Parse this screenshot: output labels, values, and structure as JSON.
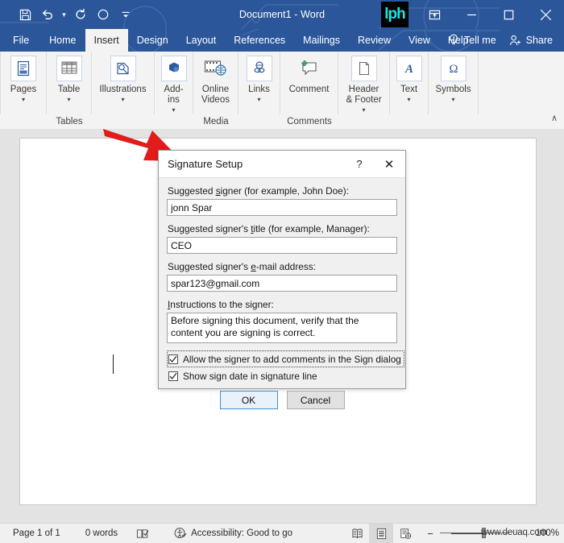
{
  "window": {
    "title": "Document1  -  Word",
    "logo_text": "lph",
    "quick_access": [
      {
        "name": "save",
        "icon": "save-icon"
      },
      {
        "name": "undo",
        "icon": "undo-icon"
      },
      {
        "name": "redo",
        "icon": "redo-icon"
      },
      {
        "name": "touch-mode",
        "icon": "circle-icon"
      },
      {
        "name": "customize-quick-access-toolbar",
        "icon": "chevron-down-icon"
      }
    ],
    "controls": [
      {
        "name": "ribbon-display-options",
        "icon": "ribbon-options-icon"
      },
      {
        "name": "minimize",
        "icon": "minimize-icon"
      },
      {
        "name": "maximize",
        "icon": "maximize-icon"
      },
      {
        "name": "close",
        "icon": "close-icon"
      }
    ]
  },
  "ribbon": {
    "tabs": [
      {
        "label": "File",
        "active": false
      },
      {
        "label": "Home",
        "active": false
      },
      {
        "label": "Insert",
        "active": true
      },
      {
        "label": "Design",
        "active": false
      },
      {
        "label": "Layout",
        "active": false
      },
      {
        "label": "References",
        "active": false
      },
      {
        "label": "Mailings",
        "active": false
      },
      {
        "label": "Review",
        "active": false
      },
      {
        "label": "View",
        "active": false
      },
      {
        "label": "Help",
        "active": false
      }
    ],
    "tell_me": "Tell me",
    "share": "Share",
    "collapse_glyph": "∧",
    "commands": [
      {
        "label": "Pages",
        "icon": "pages-icon",
        "has_chevron": true
      },
      {
        "label": "Table",
        "icon": "table-icon",
        "has_chevron": true
      },
      {
        "label": "Illustrations",
        "icon": "illustrations-icon",
        "has_chevron": true
      },
      {
        "label": "Add-ins",
        "icon": "addins-icon",
        "has_chevron": true
      },
      {
        "label": "Online Videos",
        "icon": "online-video-icon",
        "has_chevron": false
      },
      {
        "label": "Links",
        "icon": "links-icon",
        "has_chevron": true
      },
      {
        "label": "Comment",
        "icon": "comment-icon",
        "has_chevron": false
      },
      {
        "label": "Header & Footer",
        "icon": "header-footer-icon",
        "has_chevron": true
      },
      {
        "label": "Text",
        "icon": "text-icon",
        "has_chevron": true
      },
      {
        "label": "Symbols",
        "icon": "symbols-icon",
        "has_chevron": true
      }
    ],
    "group_titles": [
      "Tables",
      "Media",
      "Comments"
    ]
  },
  "dialog": {
    "title": "Signature Setup",
    "help_glyph": "?",
    "close_glyph": "✕",
    "fields": [
      {
        "name": "suggested-signer",
        "label_pre": "Suggested ",
        "label_accel": "s",
        "label_post": "igner (for example, John Doe):",
        "value": "jonn Spar"
      },
      {
        "name": "suggested-signer-title",
        "label_pre": "Suggested signer's ",
        "label_accel": "t",
        "label_post": "itle (for example, Manager):",
        "value": "CEO"
      },
      {
        "name": "suggested-signer-email",
        "label_pre": "Suggested signer's ",
        "label_accel": "e",
        "label_post": "-mail address:",
        "value": "spar123@gmail.com"
      }
    ],
    "instructions": {
      "label_pre": "",
      "label_accel": "I",
      "label_post": "nstructions to the signer:",
      "value": "Before signing this document, verify that the content you are signing is correct."
    },
    "checkboxes": [
      {
        "name": "allow-comments",
        "label": "Allow the signer to add comments in the Sign dialog",
        "checked": true,
        "focused": true
      },
      {
        "name": "show-sign-date",
        "label": "Show sign date in signature line",
        "checked": true,
        "focused": false
      }
    ],
    "buttons": [
      {
        "name": "ok",
        "label": "OK",
        "default": true
      },
      {
        "name": "cancel",
        "label": "Cancel",
        "default": false
      }
    ]
  },
  "status_bar": {
    "page": "Page 1 of 1",
    "words": "0 words",
    "proofing_icon": "proofing-icon",
    "accessibility": "Accessibility: Good to go",
    "views": [
      {
        "name": "read-mode",
        "selected": false
      },
      {
        "name": "print-layout",
        "selected": true
      },
      {
        "name": "web-layout",
        "selected": false
      }
    ],
    "zoom_out": "−",
    "zoom_in": "+",
    "zoom_level": "100%"
  },
  "annotations": {
    "arrow_color": "#e21b1b",
    "watermark": "www.deuaq.com"
  },
  "colors": {
    "word_blue": "#2b579a",
    "ribbon_bg": "#f3f3f3",
    "accent_blue": "#3b8fd0"
  }
}
